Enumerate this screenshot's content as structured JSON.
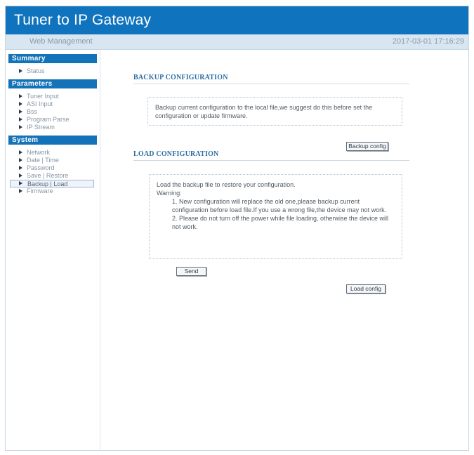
{
  "app": {
    "title": "Tuner to IP Gateway",
    "subtitle": "Web Management",
    "datetime": "2017-03-01 17:16:29"
  },
  "sidebar": {
    "summary": {
      "header": "Summary",
      "items": [
        {
          "label": "Status"
        }
      ]
    },
    "parameters": {
      "header": "Parameters",
      "items": [
        {
          "label": "Tuner Input"
        },
        {
          "label": "ASI Input"
        },
        {
          "label": "Bss"
        },
        {
          "label": "Program Parse"
        },
        {
          "label": "IP Stream"
        }
      ]
    },
    "system": {
      "header": "System",
      "items": [
        {
          "label": "Network"
        },
        {
          "label": "Date | Time"
        },
        {
          "label": "Password"
        },
        {
          "label": "Save | Restore"
        },
        {
          "label": "Backup | Load"
        },
        {
          "label": "Firmware"
        }
      ],
      "active": "Backup | Load"
    }
  },
  "backup": {
    "title": "BACKUP CONFIGURATION",
    "description": "Backup current configuration to the local file,we suggest do this before set the configuration or update firmware.",
    "button_label": "Backup config"
  },
  "load": {
    "title": "LOAD CONFIGURATION",
    "intro": "Load the backup file to restore your configuration.",
    "warning_label": "Warning:",
    "warning_1": "1. New configuration will replace the old one,please backup current configuration before load file.If you use a wrong file,the device may not work.",
    "warning_2": "2. Please do not turn off the power while file loading, otherwise the device will not work.",
    "send_label": "Send",
    "load_button_label": "Load config"
  },
  "colors": {
    "title_bar": "#0f74bd",
    "sub_bar": "#d8e6f1",
    "section_header": "#1473b8",
    "section_title": "#2a6ea3"
  }
}
